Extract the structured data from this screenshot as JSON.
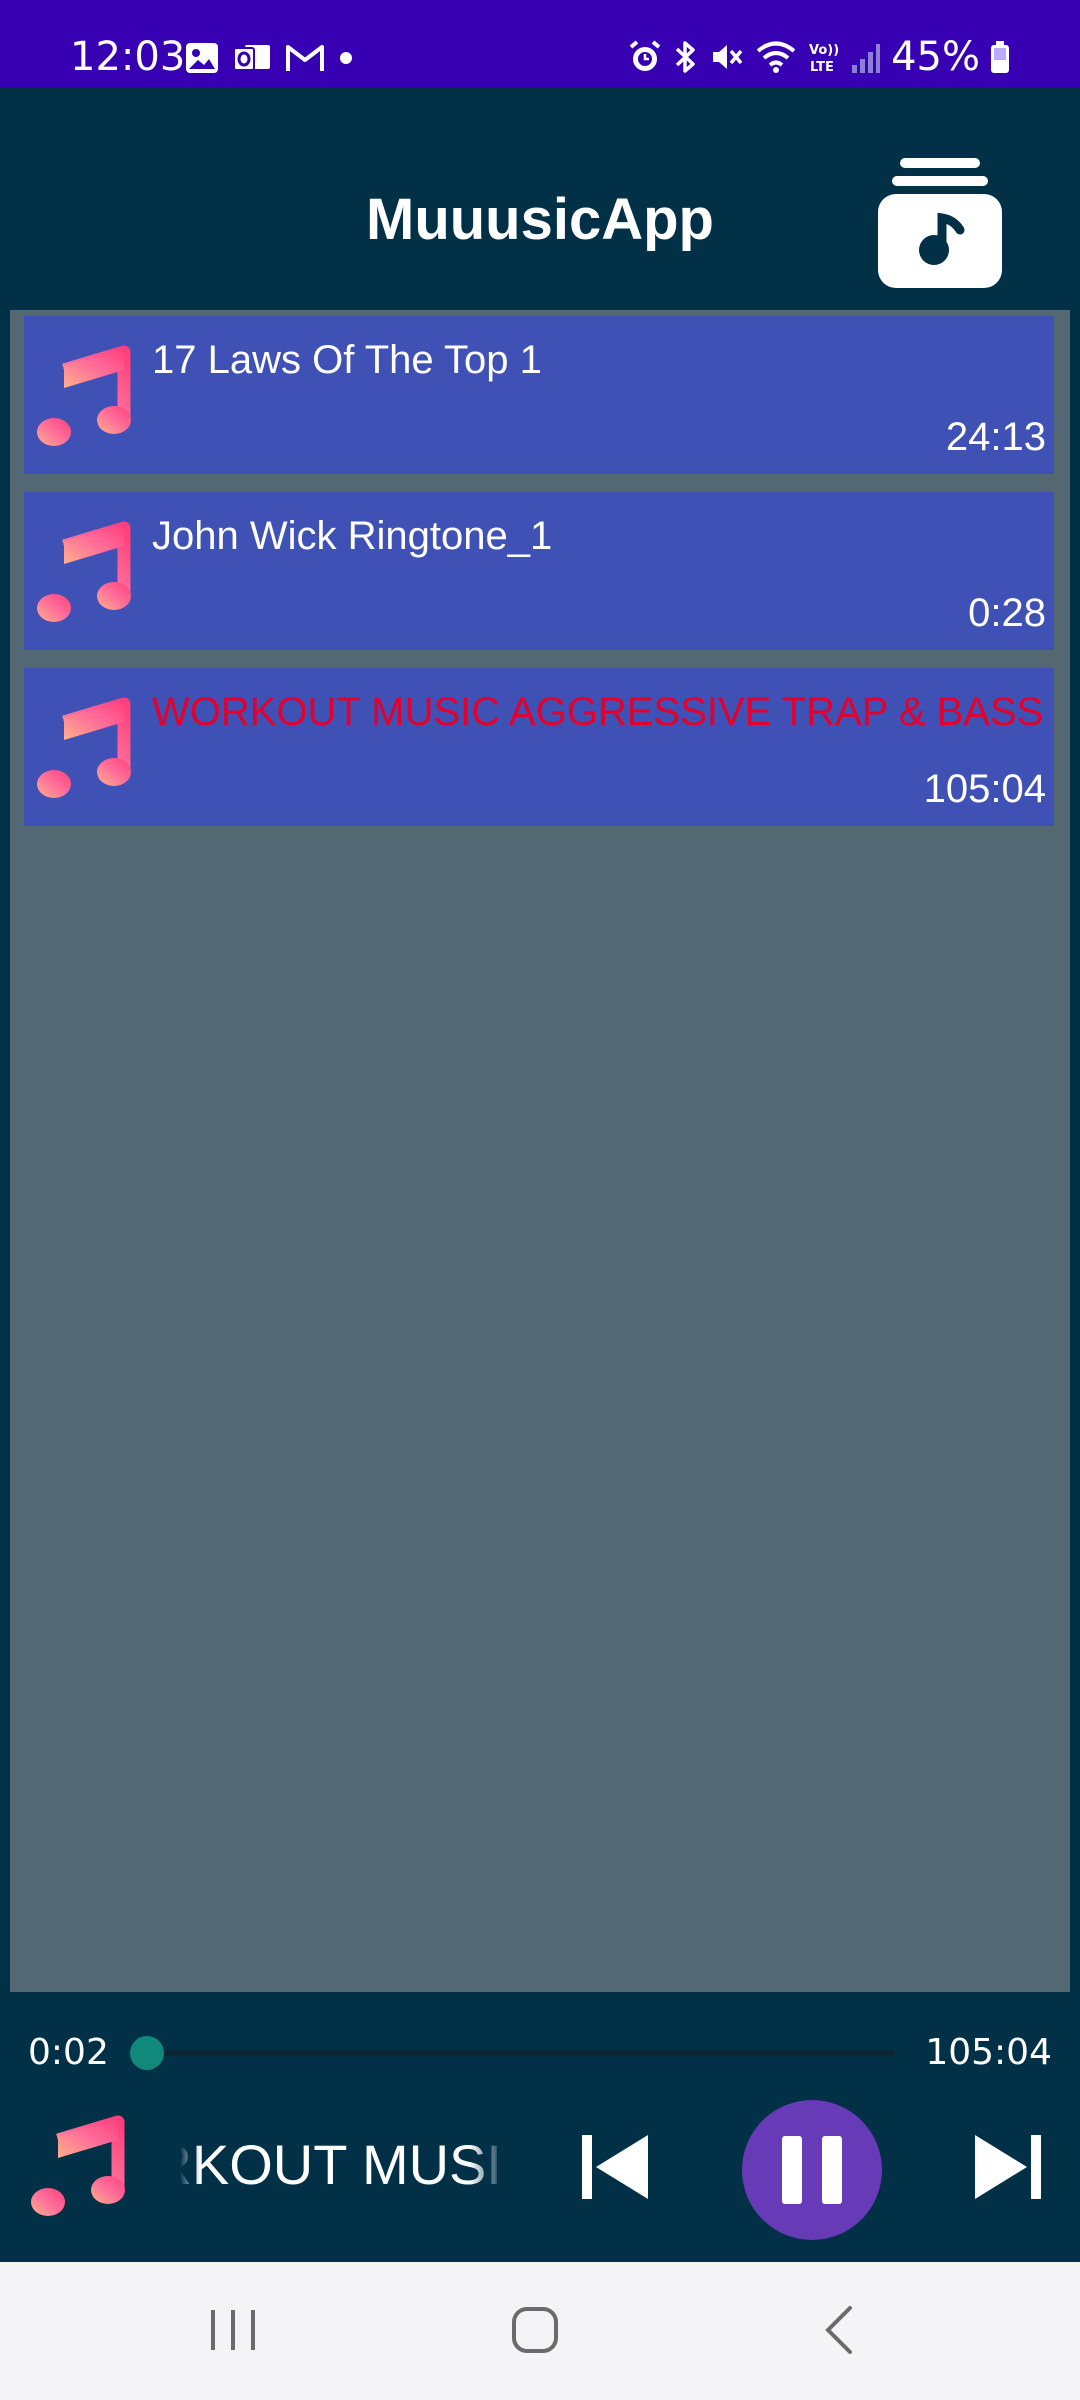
{
  "status_bar": {
    "time": "12:03",
    "battery_percent": "45%",
    "left_icons": [
      "gallery-icon",
      "outlook-icon",
      "gmail-icon",
      "dot-icon"
    ],
    "right_icons": [
      "alarm-icon",
      "bluetooth-icon",
      "mute-icon",
      "wifi-icon",
      "volte-icon",
      "signal-icon",
      "battery-icon"
    ]
  },
  "app_bar": {
    "title": "MuuusicApp",
    "logo_icon": "music-library-icon"
  },
  "tracks": [
    {
      "title": "17 Laws Of The Top 1",
      "duration": "24:13",
      "playing": false
    },
    {
      "title": "John Wick Ringtone_1",
      "duration": "0:28",
      "playing": false
    },
    {
      "title": "WORKOUT MUSIC AGGRESSIVE TRAP & BASS",
      "duration": "105:04",
      "playing": true
    }
  ],
  "player": {
    "current_time": "0:02",
    "total_time": "105:04",
    "progress_fraction": 0.003,
    "now_playing_title": "WORKOUT MUSIC AGGRESSIVE TRAP & BASS",
    "state": "playing"
  },
  "colors": {
    "status_bar": "#3700b3",
    "background": "#023047",
    "list_background": "#546873",
    "track_item": "#3f51b5",
    "playing_title": "#e4002b",
    "pause_button": "#673ab7",
    "seek": "#11897a"
  }
}
